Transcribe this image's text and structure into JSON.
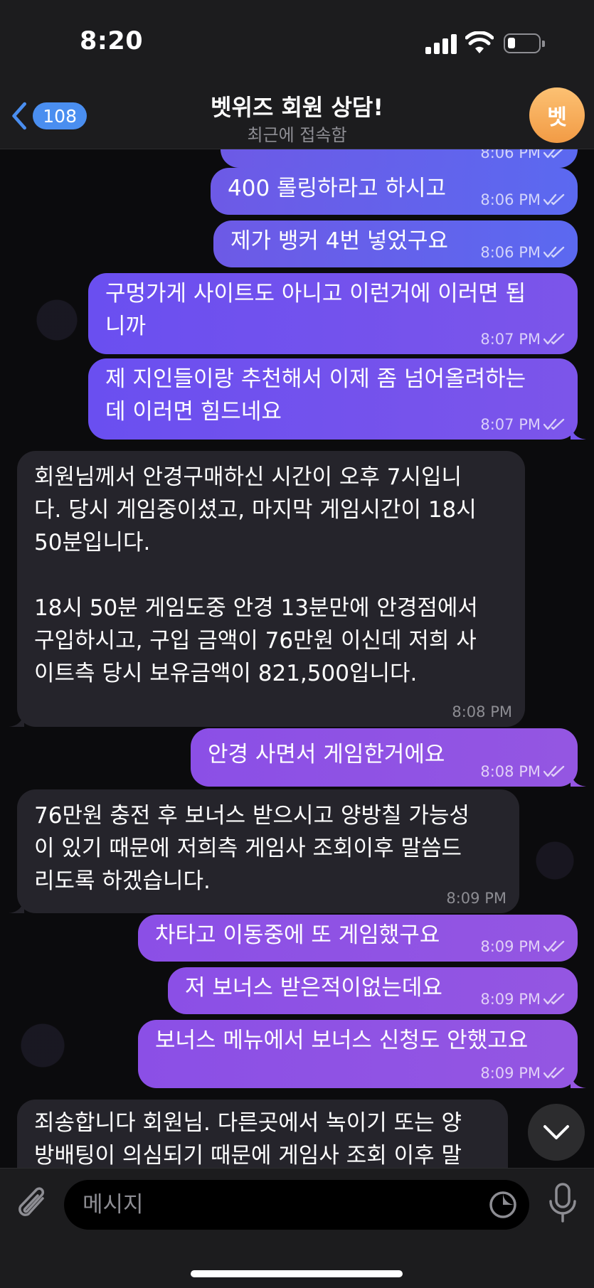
{
  "status": {
    "time": "8:20"
  },
  "header": {
    "back_count": "108",
    "title": "벳위즈 회원 상담!",
    "subtitle": "최근에 접속함",
    "avatar_letter": "벳"
  },
  "messages": [
    {
      "dir": "out",
      "text": "",
      "time": "8:06 PM"
    },
    {
      "dir": "out",
      "text": "400 롤링하라고 하시고",
      "time": "8:06 PM"
    },
    {
      "dir": "out",
      "text": "제가 뱅커 4번 넣었구요",
      "time": "8:06 PM"
    },
    {
      "dir": "out",
      "text": "구멍가게 사이트도 아니고 이런거에 이러면 됩\n니까",
      "time": "8:07 PM"
    },
    {
      "dir": "out",
      "text": "제 지인들이랑 추천해서 이제 좀 넘어올려하는\n데 이러면 힘드네요",
      "time": "8:07 PM"
    },
    {
      "dir": "in",
      "text": "회원님께서 안경구매하신 시간이 오후 7시입니\n다. 당시 게임중이셨고, 마지막 게임시간이 18시\n50분입니다.\n\n18시 50분 게임도중 안경 13분만에 안경점에서\n구입하시고, 구입 금액이 76만원 이신데 저희 사\n이트측 당시 보유금액이 821,500입니다.",
      "time": "8:08 PM"
    },
    {
      "dir": "out",
      "text": "안경 사면서 게임한거에요",
      "time": "8:08 PM"
    },
    {
      "dir": "in",
      "text": "76만원 충전 후 보너스 받으시고 양방칠 가능성\n이 있기 때문에 저희측 게임사 조회이후 말씀드\n리도록 하겠습니다.",
      "time": "8:09 PM"
    },
    {
      "dir": "out",
      "text": "차타고 이동중에 또 게임했구요",
      "time": "8:09 PM"
    },
    {
      "dir": "out",
      "text": "저 보너스 받은적이없는데요",
      "time": "8:09 PM"
    },
    {
      "dir": "out",
      "text": "보너스 메뉴에서 보너스 신청도 안했고요",
      "time": "8:09 PM"
    },
    {
      "dir": "in",
      "text": "죄송합니다 회원님. 다른곳에서 녹이기 또는 양\n방배팅이 의심되기 때문에 게임사 조회 이후 말",
      "time": ""
    }
  ],
  "input": {
    "placeholder": "메시지"
  },
  "icons": {
    "back": "chevron-left-icon",
    "attach": "paperclip-icon",
    "sticker": "sticker-icon",
    "mic": "microphone-icon",
    "scroll": "chevron-down-icon",
    "read": "double-check-icon"
  },
  "colors": {
    "outgoing_start": "#6d5ae6",
    "outgoing_end": "#9456e2",
    "incoming": "#25242b",
    "accent": "#4a8ef0",
    "avatar": "#f5a652"
  }
}
